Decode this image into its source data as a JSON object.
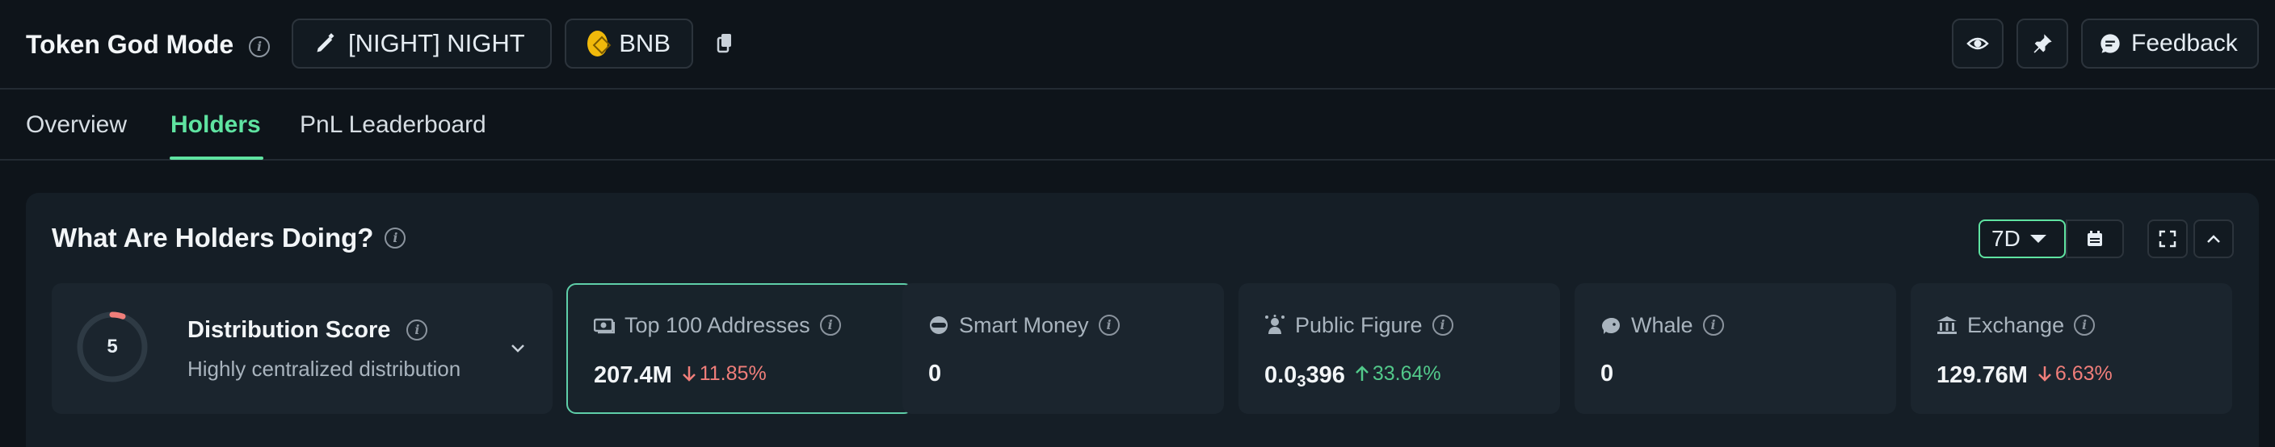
{
  "header": {
    "title": "Token God Mode",
    "token_label": "[NIGHT] NIGHT",
    "chain_label": "BNB",
    "feedback_label": "Feedback"
  },
  "tabs": [
    {
      "label": "Overview",
      "active": false
    },
    {
      "label": "Holders",
      "active": true
    },
    {
      "label": "PnL Leaderboard",
      "active": false
    }
  ],
  "panel": {
    "title": "What Are Holders Doing?",
    "range": "7D",
    "accent_color": "#5fe3a1"
  },
  "distribution": {
    "score": "5",
    "title": "Distribution Score",
    "subtitle": "Highly centralized distribution"
  },
  "cards": [
    {
      "label": "Top 100 Addresses",
      "icon": "money-icon",
      "value": "207.4M",
      "delta": "11.85%",
      "direction": "down"
    },
    {
      "label": "Smart Money",
      "icon": "smart-money-icon",
      "value": "0",
      "delta": "",
      "direction": ""
    },
    {
      "label": "Public Figure",
      "icon": "public-figure-icon",
      "value_main": "0.0",
      "value_sub": "3",
      "value_tail": "396",
      "delta": "33.64%",
      "direction": "up"
    },
    {
      "label": "Whale",
      "icon": "whale-icon",
      "value": "0",
      "delta": "",
      "direction": ""
    },
    {
      "label": "Exchange",
      "icon": "bank-icon",
      "value": "129.76M",
      "delta": "6.63%",
      "direction": "down"
    }
  ],
  "colors": {
    "down": "#f07e7a",
    "up": "#52c98a",
    "background": "#0e141a"
  }
}
